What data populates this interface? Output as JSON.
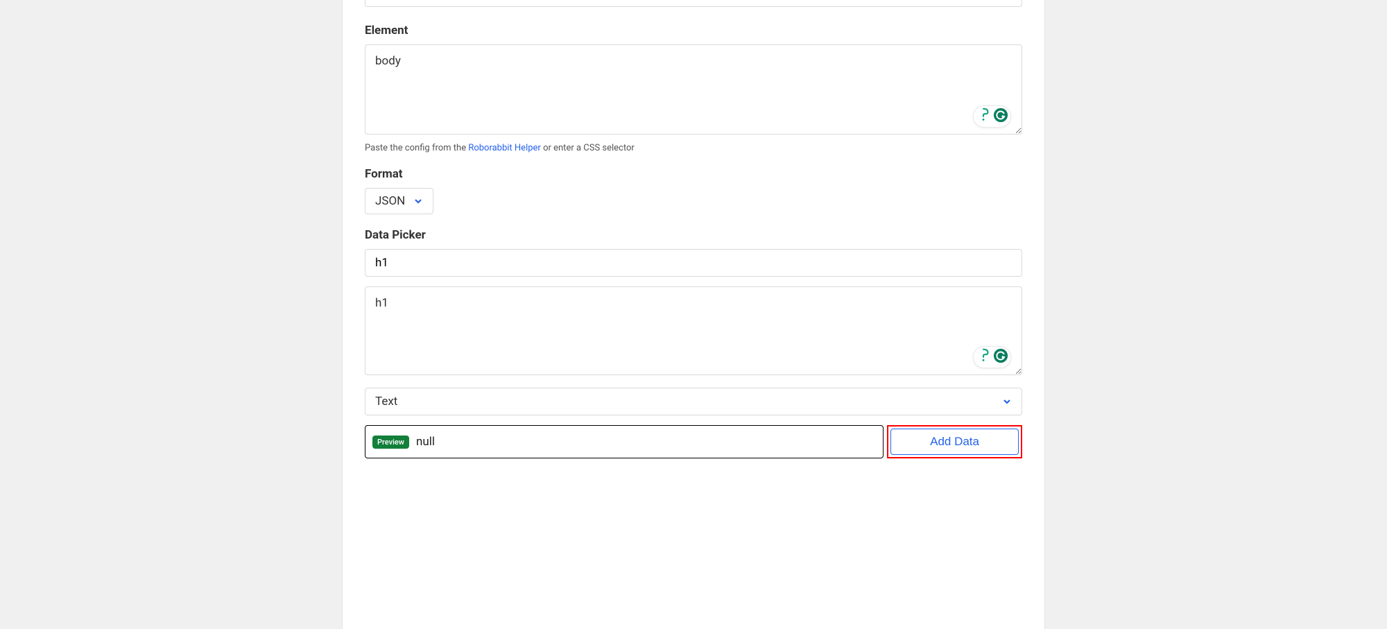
{
  "sections": {
    "element": {
      "label": "Element",
      "value": "body",
      "help_prefix": "Paste the config from the ",
      "help_link_text": "Roborabbit Helper",
      "help_suffix": " or enter a CSS selector"
    },
    "format": {
      "label": "Format",
      "value": "JSON"
    },
    "datapicker": {
      "label": "Data Picker",
      "name_value": "h1",
      "selector_value": "h1",
      "type_value": "Text",
      "preview_badge": "Preview",
      "preview_value": "null",
      "add_button": "Add Data"
    }
  }
}
